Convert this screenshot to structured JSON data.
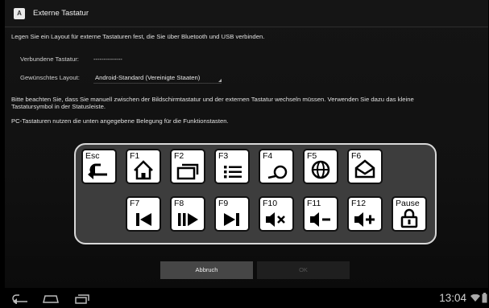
{
  "window": {
    "title": "Externe Tastatur",
    "app_icon": "keyboard-app-icon"
  },
  "intro": "Legen Sie ein Layout für externe Tastaturen fest, die Sie über Bluetooth und USB verbinden.",
  "connected": {
    "label": "Verbundene Tastatur:",
    "value": "--------------"
  },
  "layout": {
    "label": "Gewünschtes Layout:",
    "value": "Android-Standard (Vereinigte Staaten)"
  },
  "note_line1": "Bitte beachten Sie, dass Sie manuell zwischen der Bildschirmtastatur und der externen Tastatur wechseln müssen. Verwenden Sie dazu das kleine",
  "note_line2": "Tastatursymbol in der Statusleiste.",
  "pc_note": "PC-Tastaturen nutzen die unten angegebene Belegung für die Funktionstasten.",
  "keys_row1": [
    {
      "label": "Esc",
      "icon": "back-icon"
    },
    {
      "label": "F1",
      "icon": "home-icon"
    },
    {
      "label": "F2",
      "icon": "recent-apps-icon"
    },
    {
      "label": "F3",
      "icon": "menu-list-icon"
    },
    {
      "label": "F4",
      "icon": "search-icon"
    },
    {
      "label": "F5",
      "icon": "browser-globe-icon"
    },
    {
      "label": "F6",
      "icon": "email-icon"
    }
  ],
  "keys_row2": [
    {
      "label": "F7",
      "icon": "previous-track-icon"
    },
    {
      "label": "F8",
      "icon": "play-pause-icon"
    },
    {
      "label": "F9",
      "icon": "next-track-icon"
    },
    {
      "label": "F10",
      "icon": "mute-icon"
    },
    {
      "label": "F11",
      "icon": "volume-down-icon"
    },
    {
      "label": "F12",
      "icon": "volume-up-icon"
    },
    {
      "label": "Pause",
      "icon": "lock-icon"
    }
  ],
  "buttons": {
    "cancel": "Abbruch",
    "ok": "OK"
  },
  "navbar": {
    "back": "back-nav-icon",
    "home": "home-nav-icon",
    "recent": "recent-nav-icon"
  },
  "status": {
    "time": "13:04",
    "wifi": "wifi-icon",
    "battery": "battery-icon"
  }
}
